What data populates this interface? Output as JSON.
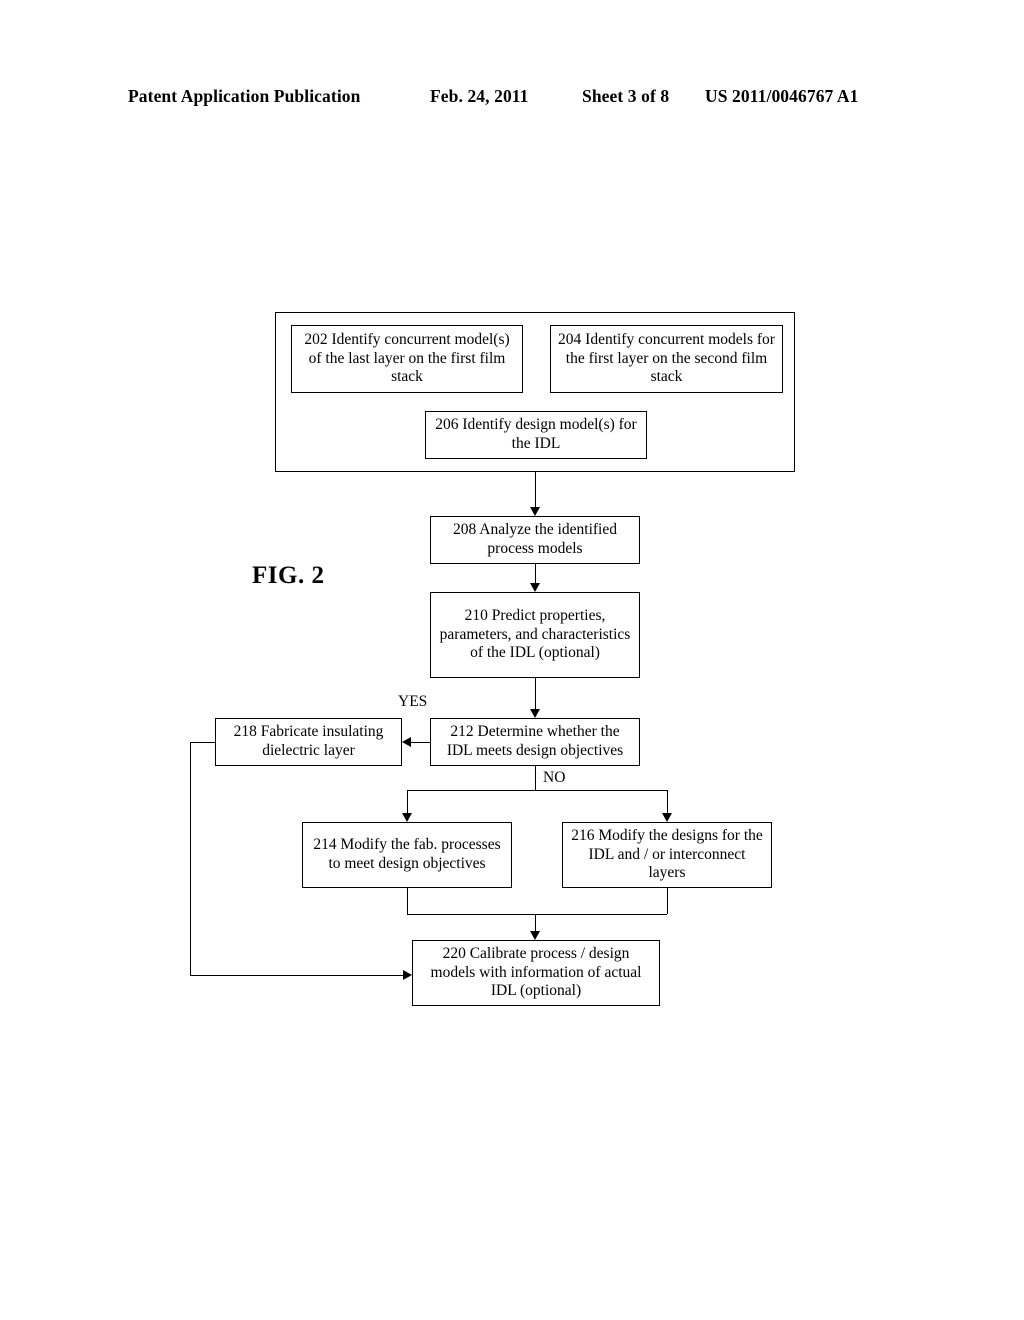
{
  "header": {
    "publication": "Patent Application Publication",
    "date": "Feb. 24, 2011",
    "sheet": "Sheet 3 of 8",
    "patent_number": "US 2011/0046767 A1"
  },
  "figure": {
    "label": "FIG. 2",
    "type": "flowchart"
  },
  "flowchart": {
    "nodes": [
      {
        "id": "202",
        "text": "202  Identify concurrent model(s) of the last layer on the first film stack"
      },
      {
        "id": "204",
        "text": "204  Identify concurrent models for the first layer on the second film stack"
      },
      {
        "id": "206",
        "text": "206  Identify design model(s) for the IDL"
      },
      {
        "id": "208",
        "text": "208  Analyze the identified process models"
      },
      {
        "id": "210",
        "text": "210  Predict properties, parameters, and characteristics of the IDL (optional)"
      },
      {
        "id": "212",
        "text": "212  Determine whether the IDL meets design objectives"
      },
      {
        "id": "218",
        "text": "218  Fabricate insulating dielectric layer"
      },
      {
        "id": "214",
        "text": "214  Modify the fab. processes to meet design objectives"
      },
      {
        "id": "216",
        "text": "216  Modify the designs for the IDL and / or interconnect layers"
      },
      {
        "id": "220",
        "text": "220  Calibrate process / design models with information of actual IDL (optional)"
      }
    ],
    "branch_labels": {
      "yes": "YES",
      "no": "NO"
    }
  }
}
